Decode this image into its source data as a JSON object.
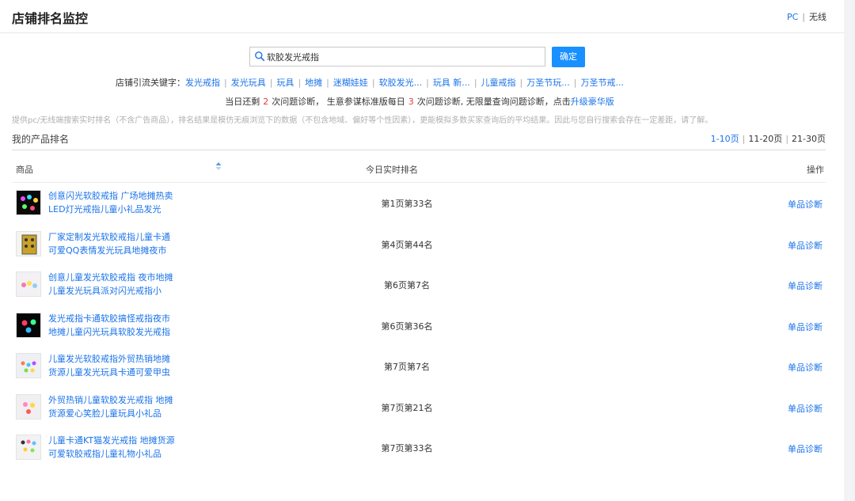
{
  "header": {
    "title": "店铺排名监控",
    "device_pc": "PC",
    "device_sep": "|",
    "device_wireless": "无线"
  },
  "search": {
    "value": "软胶发光戒指",
    "confirm_label": "确定"
  },
  "keywords": {
    "label": "店铺引流关键字：",
    "items": [
      "发光戒指",
      "发光玩具",
      "玩具",
      "地摊",
      "迷糊娃娃",
      "软胶发光...",
      "玩具 新...",
      "儿童戒指",
      "万圣节玩...",
      "万圣节戒..."
    ]
  },
  "quota": {
    "prefix": "当日还剩",
    "remaining": "2",
    "mid": "次问题诊断， 生意参谋标准版每日",
    "daily": "3",
    "suffix": "次问题诊断, 无限量查询问题诊断，点击",
    "upgrade_link": "升级豪华版"
  },
  "disclaimer": "提供pc/无线端搜索实时排名（不含广告商品），排名结果是模仿无痕浏览下的数据（不包含地域、偏好等个性因素），更能模拟多数买家查询后的平均结果。因此与您自行搜索会存在一定差距，请了解。",
  "section": {
    "title": "我的产品排名",
    "pages": [
      "1-10页",
      "11-20页",
      "21-30页"
    ]
  },
  "table": {
    "columns": [
      "商品",
      "今日实时排名",
      "操作"
    ],
    "rows": [
      {
        "title": "创意闪光软胶戒指 广场地摊热卖LED灯光戒指儿童小礼品发光",
        "rank": "第1页第33名",
        "action": "单品诊断"
      },
      {
        "title": "厂家定制发光软胶戒指儿童卡通可爱QQ表情发光玩具地摊夜市",
        "rank": "第4页第44名",
        "action": "单品诊断"
      },
      {
        "title": "创意儿童发光软胶戒指 夜市地摊儿童发光玩具派对闪光戒指小",
        "rank": "第6页第7名",
        "action": "单品诊断"
      },
      {
        "title": "发光戒指卡通软胶搞怪戒指夜市地摊儿童闪光玩具软胶发光戒指",
        "rank": "第6页第36名",
        "action": "单品诊断"
      },
      {
        "title": "儿童发光软胶戒指外贸热销地摊货源儿童发光玩具卡通可爱甲虫",
        "rank": "第7页第7名",
        "action": "单品诊断"
      },
      {
        "title": "外贸热销儿童软胶发光戒指 地摊货源爱心笑脸儿童玩具小礼品",
        "rank": "第7页第21名",
        "action": "单品诊断"
      },
      {
        "title": "儿童卡通KT猫发光戒指 地摊货源可爱软胶戒指儿童礼物小礼品",
        "rank": "第7页第33名",
        "action": "单品诊断"
      }
    ]
  },
  "colors": {
    "link": "#1a73e8",
    "accent_button": "#1890ff",
    "highlight_number": "#e4393c"
  },
  "icons": [
    "search-icon",
    "sort-icon",
    "product-thumbnail"
  ]
}
